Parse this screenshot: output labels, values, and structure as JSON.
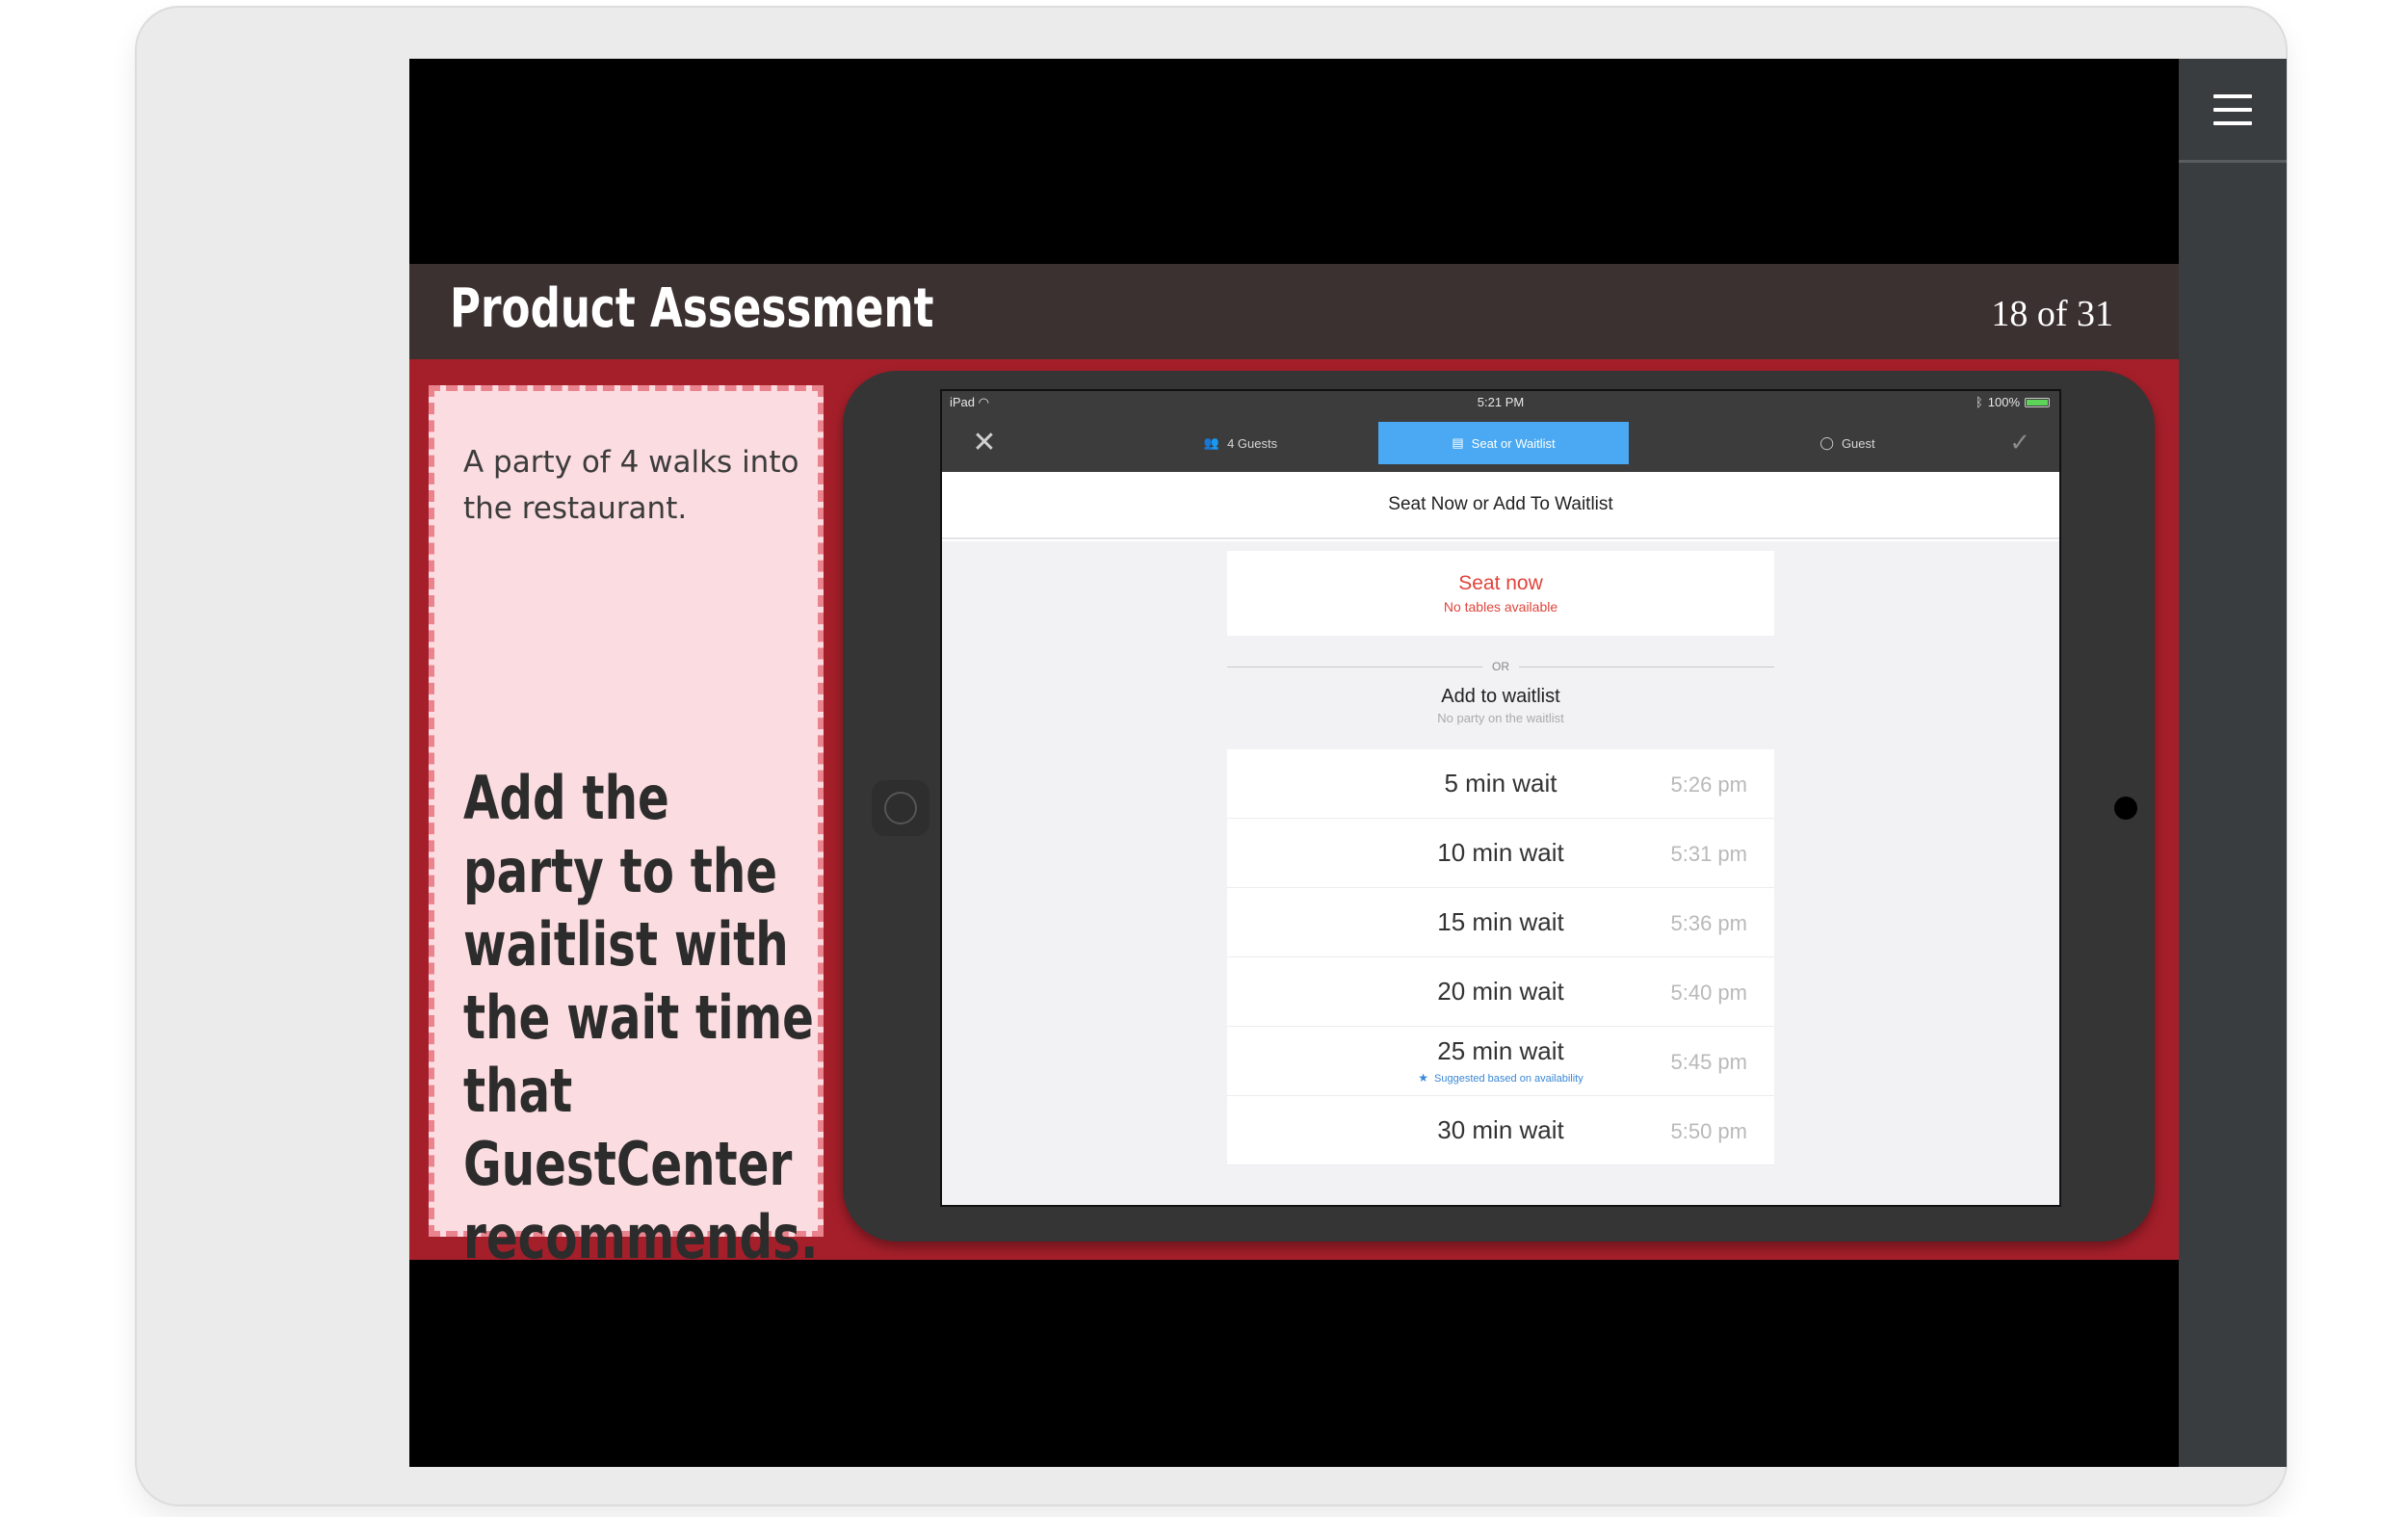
{
  "slide": {
    "title": "Product Assessment",
    "counter": "18 of 31",
    "scenario": "A party of 4 walks into the restaurant.",
    "task": "Add the party to the waitlist with the wait time that GuestCenter recommends."
  },
  "menu": {
    "icon": "hamburger-menu-icon"
  },
  "ipad": {
    "status": {
      "device": "iPad",
      "time": "5:21 PM",
      "battery": "100%"
    },
    "toolbar": {
      "close_icon": "close-icon",
      "tabs": [
        {
          "label": "4 Guests",
          "icon": "guests-icon"
        },
        {
          "label": "Seat or Waitlist",
          "icon": "seat-icon"
        },
        {
          "label": "Guest",
          "icon": "guest-icon"
        }
      ],
      "confirm_icon": "checkmark-icon"
    },
    "sheet_title": "Seat Now or Add To Waitlist",
    "seat_now": {
      "title": "Seat now",
      "subtitle": "No tables available"
    },
    "or_label": "OR",
    "waitlist": {
      "title": "Add to waitlist",
      "subtitle": "No party on the waitlist"
    },
    "options": [
      {
        "label": "5 min wait",
        "time": "5:26 pm"
      },
      {
        "label": "10 min wait",
        "time": "5:31 pm"
      },
      {
        "label": "15 min wait",
        "time": "5:36 pm"
      },
      {
        "label": "20 min wait",
        "time": "5:40 pm"
      },
      {
        "label": "25 min wait",
        "time": "5:45 pm",
        "note": "Suggested based on availability"
      },
      {
        "label": "30 min wait",
        "time": "5:50 pm"
      }
    ]
  },
  "colors": {
    "accent_red": "#a51f2a",
    "title_bar": "#3b3130",
    "active_tab": "#4aa9f2",
    "seat_now_red": "#e0443b"
  }
}
